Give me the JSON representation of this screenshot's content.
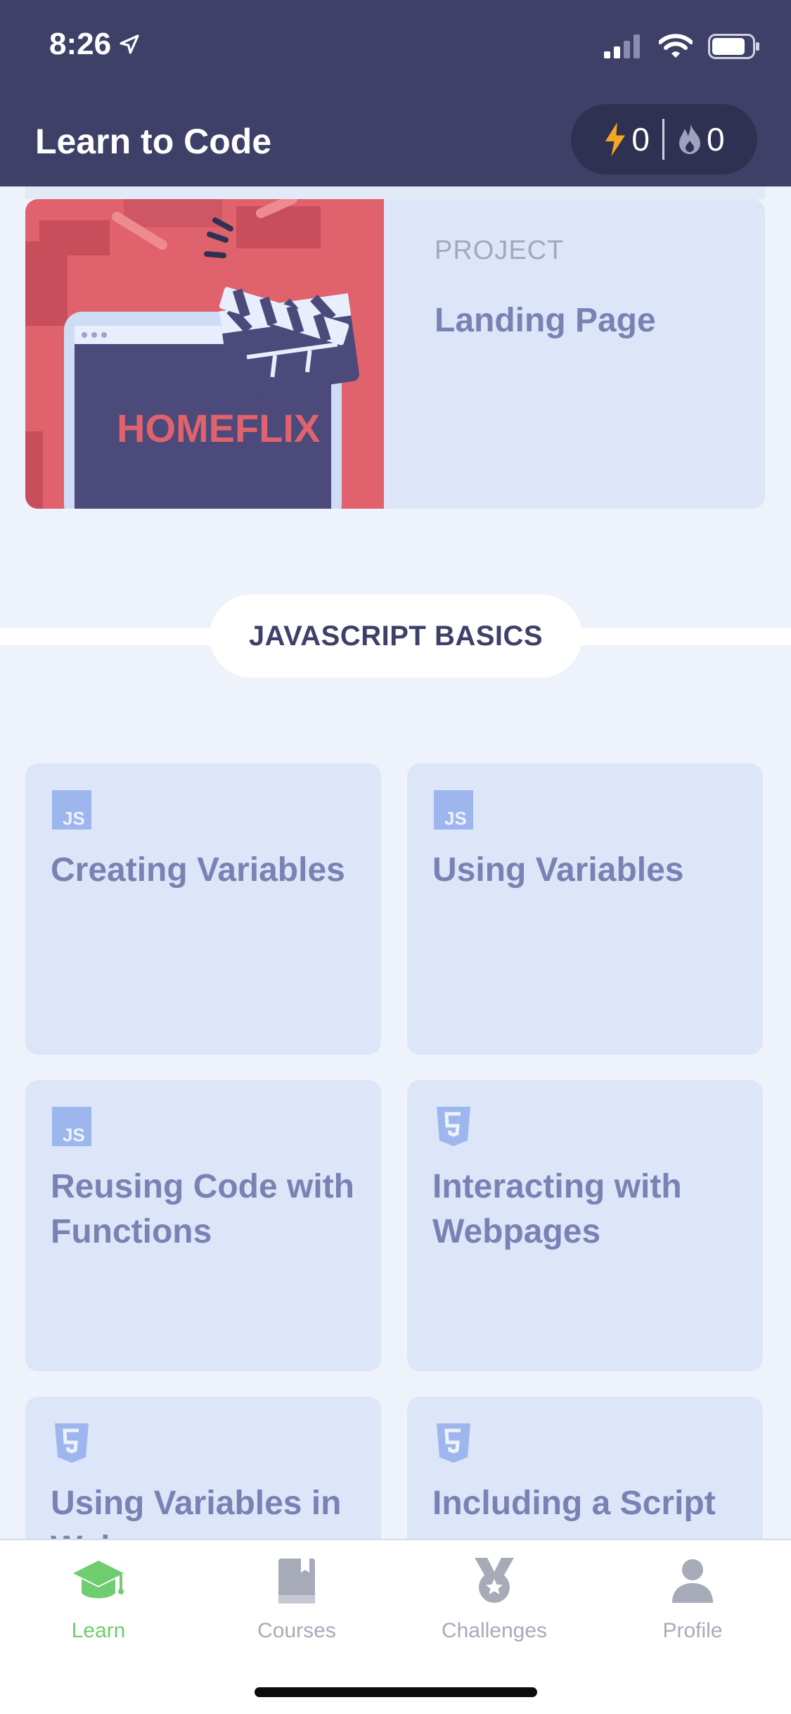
{
  "status_bar": {
    "time": "8:26",
    "icons": [
      "location-arrow-icon",
      "signal-icon",
      "wifi-icon",
      "battery-icon"
    ]
  },
  "header": {
    "title": "Learn to Code",
    "stats": {
      "bolt_count": "0",
      "streak_count": "0"
    }
  },
  "project": {
    "tag": "PROJECT",
    "title": "Landing Page",
    "image_text": "HOMEFLIX"
  },
  "section": {
    "title": "JAVASCRIPT BASICS"
  },
  "lessons": [
    {
      "title": "Creating Variables",
      "icon": "js-icon"
    },
    {
      "title": "Using Variables",
      "icon": "js-icon"
    },
    {
      "title": "Reusing Code with Functions",
      "icon": "js-icon"
    },
    {
      "title": "Interacting with Webpages",
      "icon": "html5-icon"
    },
    {
      "title": "Using Variables in Web",
      "icon": "html5-icon"
    },
    {
      "title": "Including a Script",
      "icon": "html5-icon"
    }
  ],
  "tabs": [
    {
      "label": "Learn",
      "icon": "graduation-cap-icon",
      "active": true
    },
    {
      "label": "Courses",
      "icon": "book-icon",
      "active": false
    },
    {
      "label": "Challenges",
      "icon": "medal-icon",
      "active": false
    },
    {
      "label": "Profile",
      "icon": "person-icon",
      "active": false
    }
  ],
  "colors": {
    "header_bg": "#3e4068",
    "card_bg": "#dce6f8",
    "card_text": "#7a82b3",
    "active_tab": "#6fcd6f",
    "accent_orange": "#f5a623",
    "project_red": "#e0626d"
  }
}
